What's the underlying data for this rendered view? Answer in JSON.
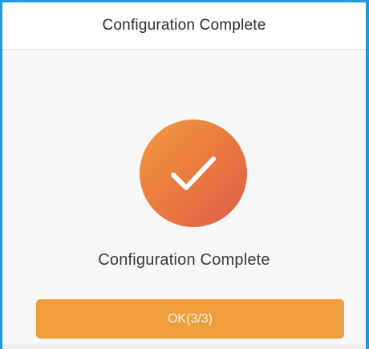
{
  "header": {
    "title": "Configuration Complete"
  },
  "status": {
    "icon": "checkmark-icon",
    "icon_colors": [
      "#f29a3e",
      "#de5d4a"
    ],
    "message": "Configuration Complete"
  },
  "actions": {
    "ok_label": "OK(3/3)",
    "ok_color": "#ee9e3c"
  },
  "accent": {
    "border_color": "#1e9be0"
  }
}
